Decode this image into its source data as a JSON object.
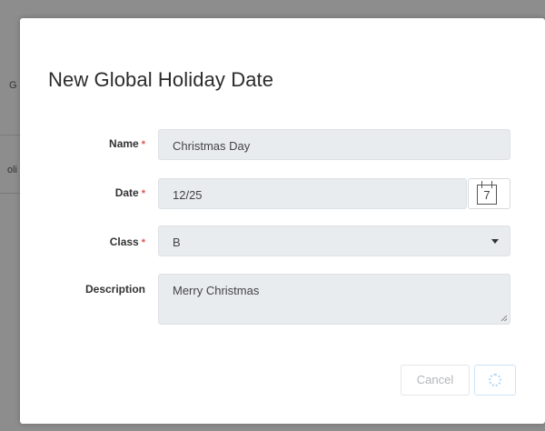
{
  "background": {
    "fragment_1": "G",
    "fragment_2": "oli"
  },
  "dialog": {
    "title": "New Global Holiday Date",
    "fields": {
      "name": {
        "label": "Name",
        "required_mark": "*",
        "value": "Christmas Day"
      },
      "date": {
        "label": "Date",
        "required_mark": "*",
        "value": "12/25",
        "calendar_day": "7"
      },
      "class": {
        "label": "Class",
        "required_mark": "*",
        "value": "B"
      },
      "description": {
        "label": "Description",
        "value": "Merry Christmas"
      }
    },
    "buttons": {
      "cancel": "Cancel"
    }
  },
  "icons": {
    "calendar": "calendar-icon",
    "dropdown": "chevron-down-icon",
    "loading": "spinner-icon",
    "resize": "resize-grip-icon"
  },
  "colors": {
    "required": "#e0564f",
    "field_bg": "#e9ecef",
    "overlay": "#8e8e8e"
  }
}
